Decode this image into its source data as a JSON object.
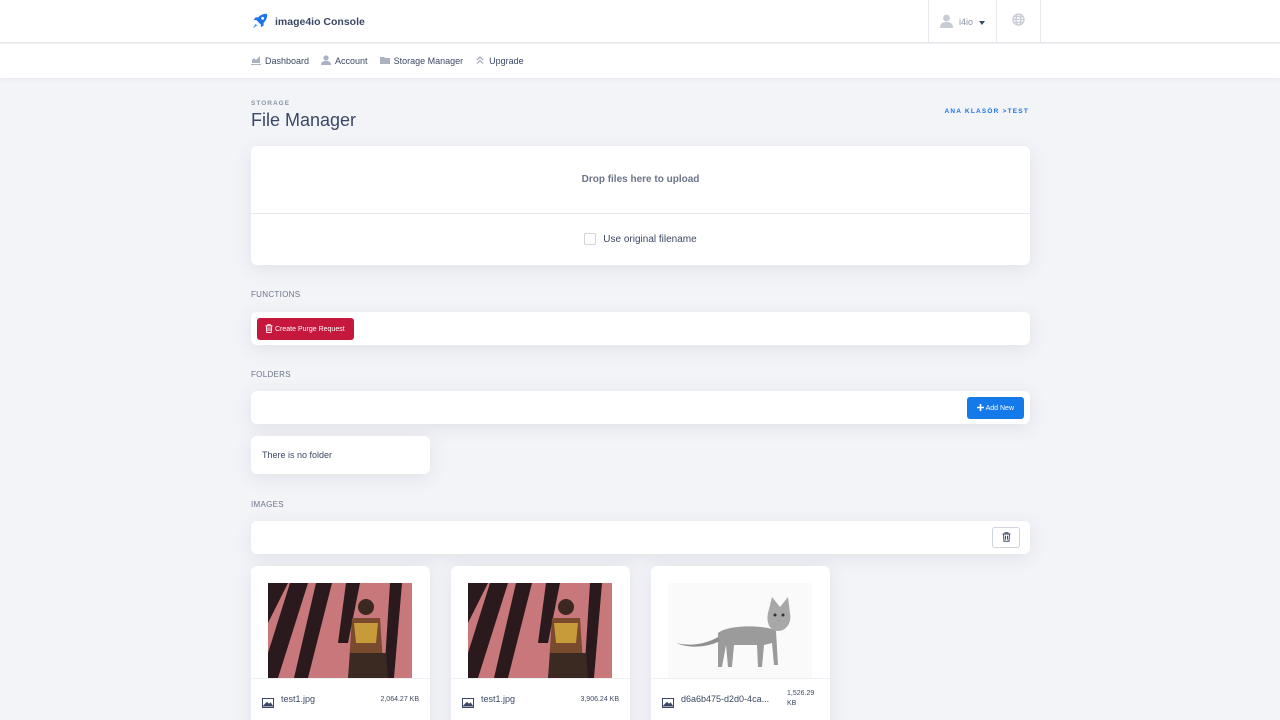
{
  "app": {
    "title": "image4io Console"
  },
  "user": {
    "name": "i4io"
  },
  "nav": {
    "items": [
      {
        "label": "Dashboard",
        "icon": "chart-icon"
      },
      {
        "label": "Account",
        "icon": "user-icon"
      },
      {
        "label": "Storage Manager",
        "icon": "folder-icon"
      },
      {
        "label": "Upgrade",
        "icon": "upgrade-icon"
      }
    ]
  },
  "page": {
    "section": "STORAGE",
    "title": "File Manager",
    "breadcrumb": "ANA KLASÖR >TEST"
  },
  "upload": {
    "drop_text": "Drop files here to upload",
    "original_filename_label": "Use original filename",
    "original_filename_checked": false
  },
  "functions": {
    "label": "FUNCTIONS",
    "purge_button": "Create Purge Request"
  },
  "folders": {
    "label": "FOLDERS",
    "add_button": "Add New",
    "empty_text": "There is no folder"
  },
  "images": {
    "label": "IMAGES",
    "items": [
      {
        "name": "test1.jpg",
        "size": "2,064.27 KB"
      },
      {
        "name": "test1.jpg",
        "size": "3,906.24 KB"
      },
      {
        "name": "d6a6b475-d2d0-4ca...",
        "size": "1,526.29 KB"
      }
    ]
  },
  "colors": {
    "accent": "#1479e9",
    "danger": "#c6183d",
    "text": "#3b4863",
    "background": "#f3f4f8"
  }
}
